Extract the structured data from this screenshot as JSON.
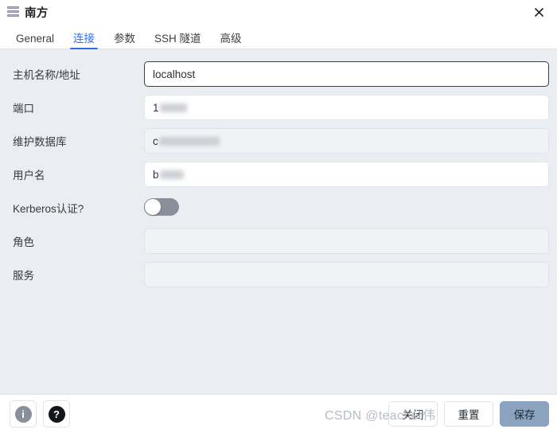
{
  "window": {
    "title": "南方",
    "icon": "server-stack-icon",
    "close_label": "×"
  },
  "tabs": [
    {
      "label": "General",
      "active": false
    },
    {
      "label": "连接",
      "active": true
    },
    {
      "label": "参数",
      "active": false
    },
    {
      "label": "SSH 隧道",
      "active": false
    },
    {
      "label": "高级",
      "active": false
    }
  ],
  "form": {
    "fields": [
      {
        "label": "主机名称/地址",
        "value": "localhost",
        "state": "focused",
        "redacted": false
      },
      {
        "label": "端口",
        "value": "1",
        "state": "filled",
        "redacted": true
      },
      {
        "label": "维护数据库",
        "value": "c",
        "state": "empty",
        "redacted": true
      },
      {
        "label": "用户名",
        "value": "b",
        "state": "filled",
        "redacted": true
      },
      {
        "label": "Kerberos认证?",
        "value": "",
        "state": "toggle",
        "toggle_on": false
      },
      {
        "label": "角色",
        "value": "",
        "state": "empty",
        "redacted": false
      },
      {
        "label": "服务",
        "value": "",
        "state": "empty",
        "redacted": false
      }
    ]
  },
  "footer": {
    "info_label": "i",
    "help_label": "?",
    "buttons": [
      {
        "label": "关闭",
        "primary": false
      },
      {
        "label": "重置",
        "primary": false
      },
      {
        "label": "保存",
        "primary": true
      }
    ]
  },
  "watermark": {
    "text": "CSDN @teacher伟"
  },
  "colors": {
    "accent": "#326ce5",
    "body_bg": "#eaedf1",
    "panel_bg": "#ffffff",
    "primary_button": "#8ba3bf"
  }
}
